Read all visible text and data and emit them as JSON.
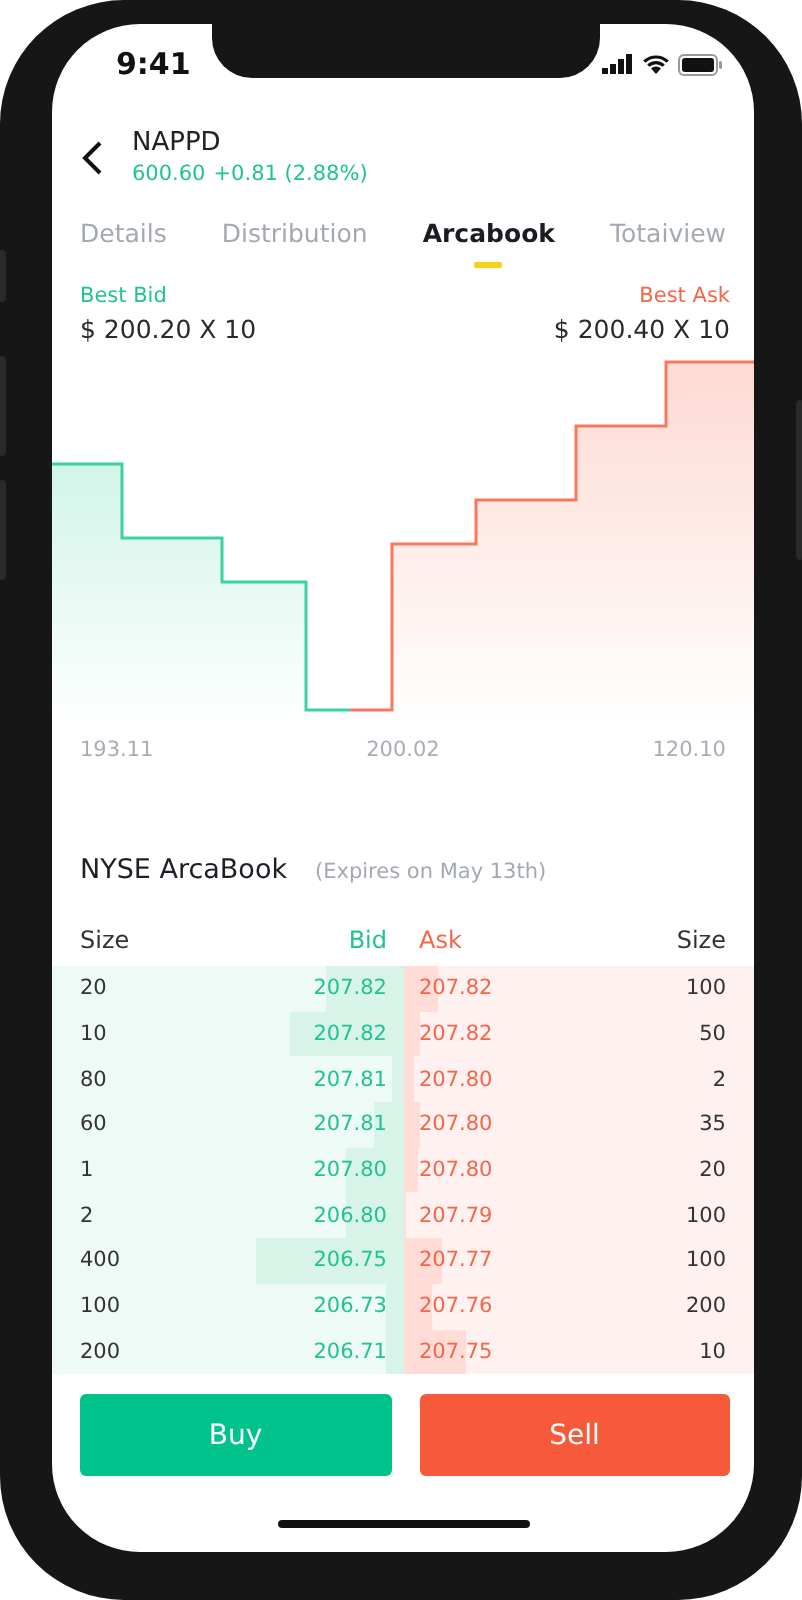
{
  "status_bar": {
    "time": "9:41"
  },
  "header": {
    "symbol": "NAPPD",
    "price": "600.60",
    "change": "+0.81 (2.88%)"
  },
  "tabs": [
    {
      "label": "Details",
      "selected": false
    },
    {
      "label": "Distribution",
      "selected": false
    },
    {
      "label": "Arcabook",
      "selected": true
    },
    {
      "label": "Totaiview",
      "selected": false
    }
  ],
  "best_bid": {
    "label": "Best Bid",
    "value": "$ 200.20 X 10"
  },
  "best_ask": {
    "label": "Best Ask",
    "value": "$ 200.40 X 10"
  },
  "depth_chart": {
    "x_labels": [
      "193.11",
      "200.02",
      "120.10"
    ]
  },
  "book": {
    "title": "NYSE ArcaBook",
    "note": "(Expires on May 13th)",
    "columns": [
      "Size",
      "Bid",
      "Ask",
      "Size"
    ],
    "rows": [
      {
        "bid_size": "20",
        "bid": "207.82",
        "ask": "207.82",
        "ask_size": "100",
        "bid_bar": {
          "level": 0.22
        },
        "ask_bar": {
          "level": 0.1
        }
      },
      {
        "bid_size": "10",
        "bid": "207.82",
        "ask": "207.82",
        "ask_size": "50",
        "bid_bar": {
          "level": 0.32
        },
        "ask_bar": {
          "level": 0.05
        }
      },
      {
        "bid_size": "80",
        "bid": "207.81",
        "ask": "207.80",
        "ask_size": "2",
        "bid_bar": {
          "level": 0.03
        },
        "ask_bar": {
          "level": 0.03
        }
      },
      {
        "bid_size": "60",
        "bid": "207.81",
        "ask": "207.80",
        "ask_size": "35",
        "bid_bar": {
          "level": 0.08
        },
        "ask_bar": {
          "level": 0.05
        }
      },
      {
        "bid_size": "1",
        "bid": "207.80",
        "ask": "207.80",
        "ask_size": "20",
        "bid_bar": {
          "level": 0.16
        },
        "ask_bar": {
          "level": 0.04
        }
      },
      {
        "bid_size": "2",
        "bid": "206.80",
        "ask": "207.79",
        "ask_size": "100",
        "bid_bar": {
          "level": 0.16
        },
        "ask_bar": {
          "level": 0.01
        }
      },
      {
        "bid_size": "400",
        "bid": "206.75",
        "ask": "207.77",
        "ask_size": "100",
        "bid_bar": {
          "level": 0.42
        },
        "ask_bar": {
          "level": 0.11
        }
      },
      {
        "bid_size": "100",
        "bid": "206.73",
        "ask": "207.76",
        "ask_size": "200",
        "bid_bar": {
          "level": 0.05
        },
        "ask_bar": {
          "level": 0.08
        }
      },
      {
        "bid_size": "200",
        "bid": "206.71",
        "ask": "207.75",
        "ask_size": "10",
        "bid_bar": {
          "level": 0.05
        },
        "ask_bar": {
          "level": 0.18
        }
      }
    ]
  },
  "buttons": [
    {
      "label": "Buy",
      "kind": "buy"
    },
    {
      "label": "Sell",
      "kind": "sell"
    }
  ]
}
